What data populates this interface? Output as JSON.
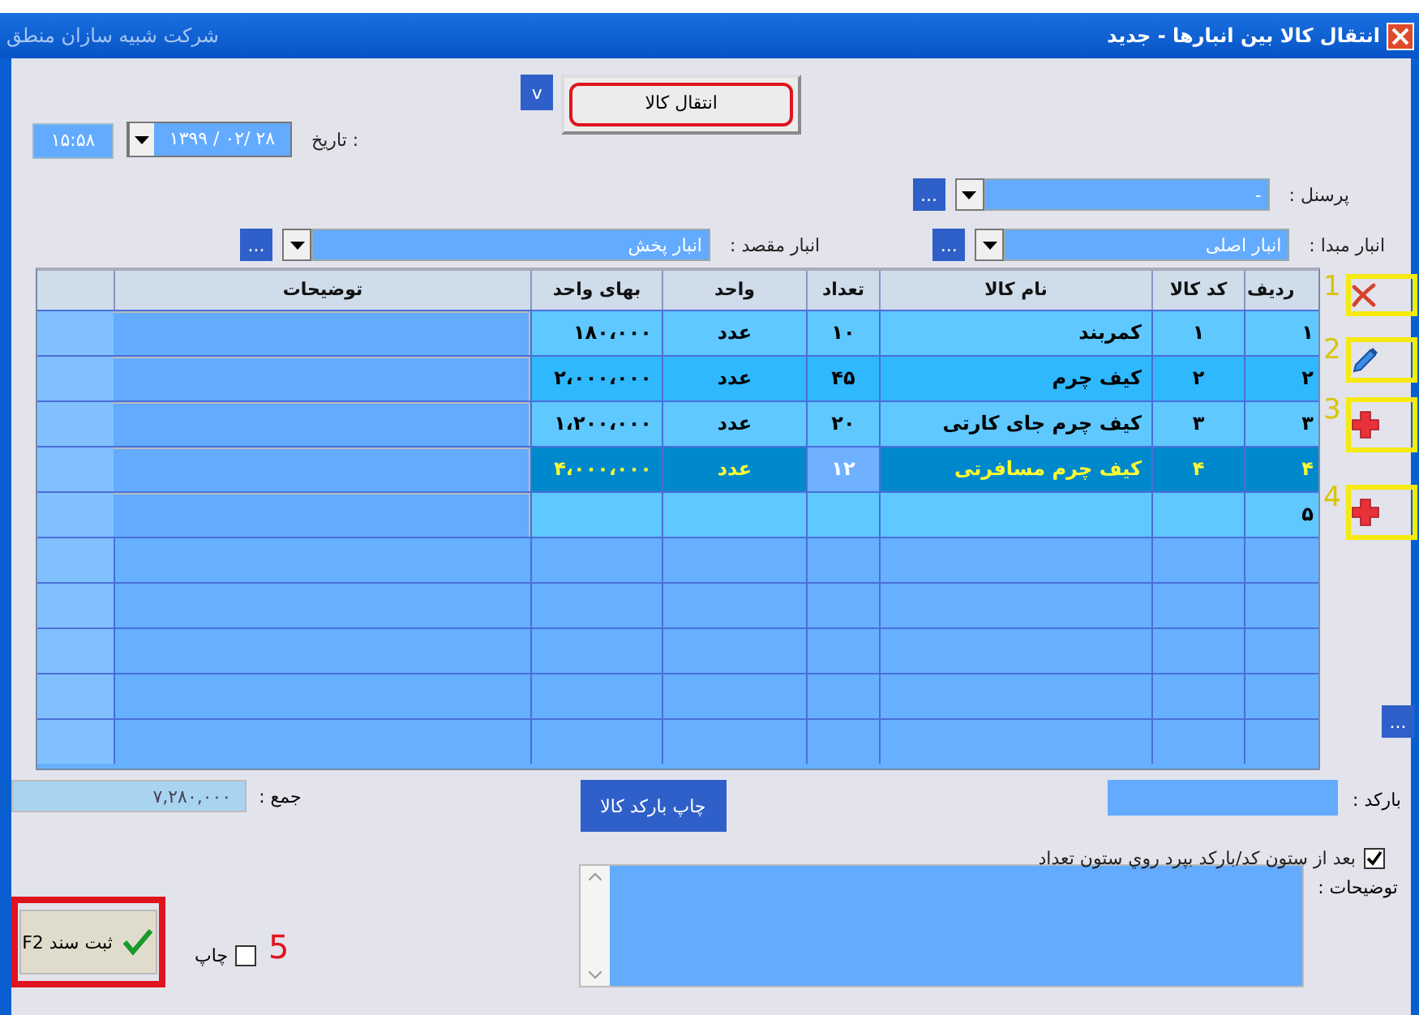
{
  "window": {
    "title": "انتقال کالا بین انبارها - جدید",
    "company": "شرکت شبیه سازان منطق"
  },
  "header": {
    "transfer_button": {
      "label": "انتقال کالا",
      "highlighted": true
    },
    "v_button": "v",
    "date_label": "تاریخ :",
    "date_value": "۱۳۹۹ / ۰۲/ ۲۸",
    "time": "۱۵:۵۸"
  },
  "personnel": {
    "label": "پرسنل :",
    "value": "-",
    "more": "..."
  },
  "source_store": {
    "label": "انبار مبدا :",
    "value": "انبار اصلی",
    "more": "..."
  },
  "target_store": {
    "label": "انبار مقصد :",
    "value": "انبار پخش",
    "more": "..."
  },
  "side_tools": [
    {
      "kind": "delete",
      "callout": "1"
    },
    {
      "kind": "edit",
      "callout": "2"
    },
    {
      "kind": "add",
      "callout": "3"
    },
    {
      "kind": "add",
      "callout": "4"
    }
  ],
  "grid_more": "...",
  "table": {
    "columns": [
      "ردیف",
      "کد کالا",
      "نام کالا",
      "تعداد",
      "واحد",
      "بهای واحد",
      "توضیحات"
    ],
    "rows": [
      {
        "row_no": "۱",
        "code": "۱",
        "name": "کمربند",
        "qty": "۱۰",
        "unit": "عدد",
        "price": "۱۸۰،۰۰۰",
        "selected": false
      },
      {
        "row_no": "۲",
        "code": "۲",
        "name": "کیف چرم",
        "qty": "۴۵",
        "unit": "عدد",
        "price": "۲،۰۰۰،۰۰۰",
        "selected": false
      },
      {
        "row_no": "۳",
        "code": "۳",
        "name": "کیف چرم جای کارتی",
        "qty": "۲۰",
        "unit": "عدد",
        "price": "۱،۲۰۰،۰۰۰",
        "selected": false
      },
      {
        "row_no": "۴",
        "code": "۴",
        "name": "کیف چرم مسافرتی",
        "qty": "۱۲",
        "unit": "عدد",
        "price": "۴،۰۰۰،۰۰۰",
        "selected": true
      },
      {
        "row_no": "۵",
        "selected": false
      }
    ]
  },
  "total": {
    "label": "جمع :",
    "value": "۷,۲۸۰,۰۰۰"
  },
  "print_barcode_button": "چاپ بارکد کالا",
  "barcode": {
    "label": "بارکد :"
  },
  "jump_option": {
    "label": "بعد از ستون کد/بارکد بپرد روي ستون تعداد",
    "checked": true
  },
  "notes": {
    "label": "توضیحات :"
  },
  "print_option": {
    "label": "چاپ",
    "checked": false,
    "callout": "5"
  },
  "submit_button": {
    "label": "ثبت سند F2",
    "highlighted": true
  }
}
